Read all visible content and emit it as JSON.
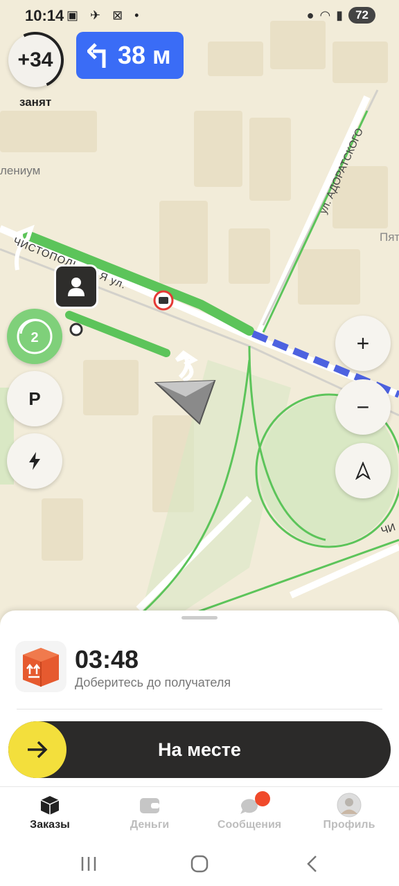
{
  "status_bar": {
    "time": "10:14",
    "left_icons": "▣ ✈ ⊠ •",
    "battery": "72",
    "icons": [
      "location-icon",
      "wifi-icon",
      "signal-icon",
      "battery-icon"
    ]
  },
  "busy": {
    "value": "+34",
    "label": "занят"
  },
  "maneuver": {
    "distance": "38 м",
    "icon": "turn-left-icon"
  },
  "map_labels": {
    "place_left": "лениум",
    "street_top": "ул. АДОРАТСКОГО",
    "street_main": "ЧИСТОПОЛЬСКАЯ ул.",
    "street_right": "Пят",
    "street_bottom_right": "ЧИ"
  },
  "map_controls": {
    "cluster_count": "2",
    "parking": "P",
    "zoom_in": "+",
    "zoom_out": "−"
  },
  "order": {
    "timer": "03:48",
    "subtitle": "Доберитесь до получателя",
    "action": "На месте"
  },
  "tabs": [
    {
      "label": "Заказы",
      "icon": "box-icon",
      "active": true
    },
    {
      "label": "Деньги",
      "icon": "wallet-icon",
      "active": false
    },
    {
      "label": "Сообщения",
      "icon": "chat-icon",
      "active": false,
      "badge": true
    },
    {
      "label": "Профиль",
      "icon": "avatar-icon",
      "active": false
    }
  ],
  "colors": {
    "route_green": "#5cc45a",
    "route_blue": "#4d62e0",
    "maneuver_blue": "#3a6cf6",
    "action_yellow": "#f3df3c",
    "badge_red": "#f04a2b"
  }
}
